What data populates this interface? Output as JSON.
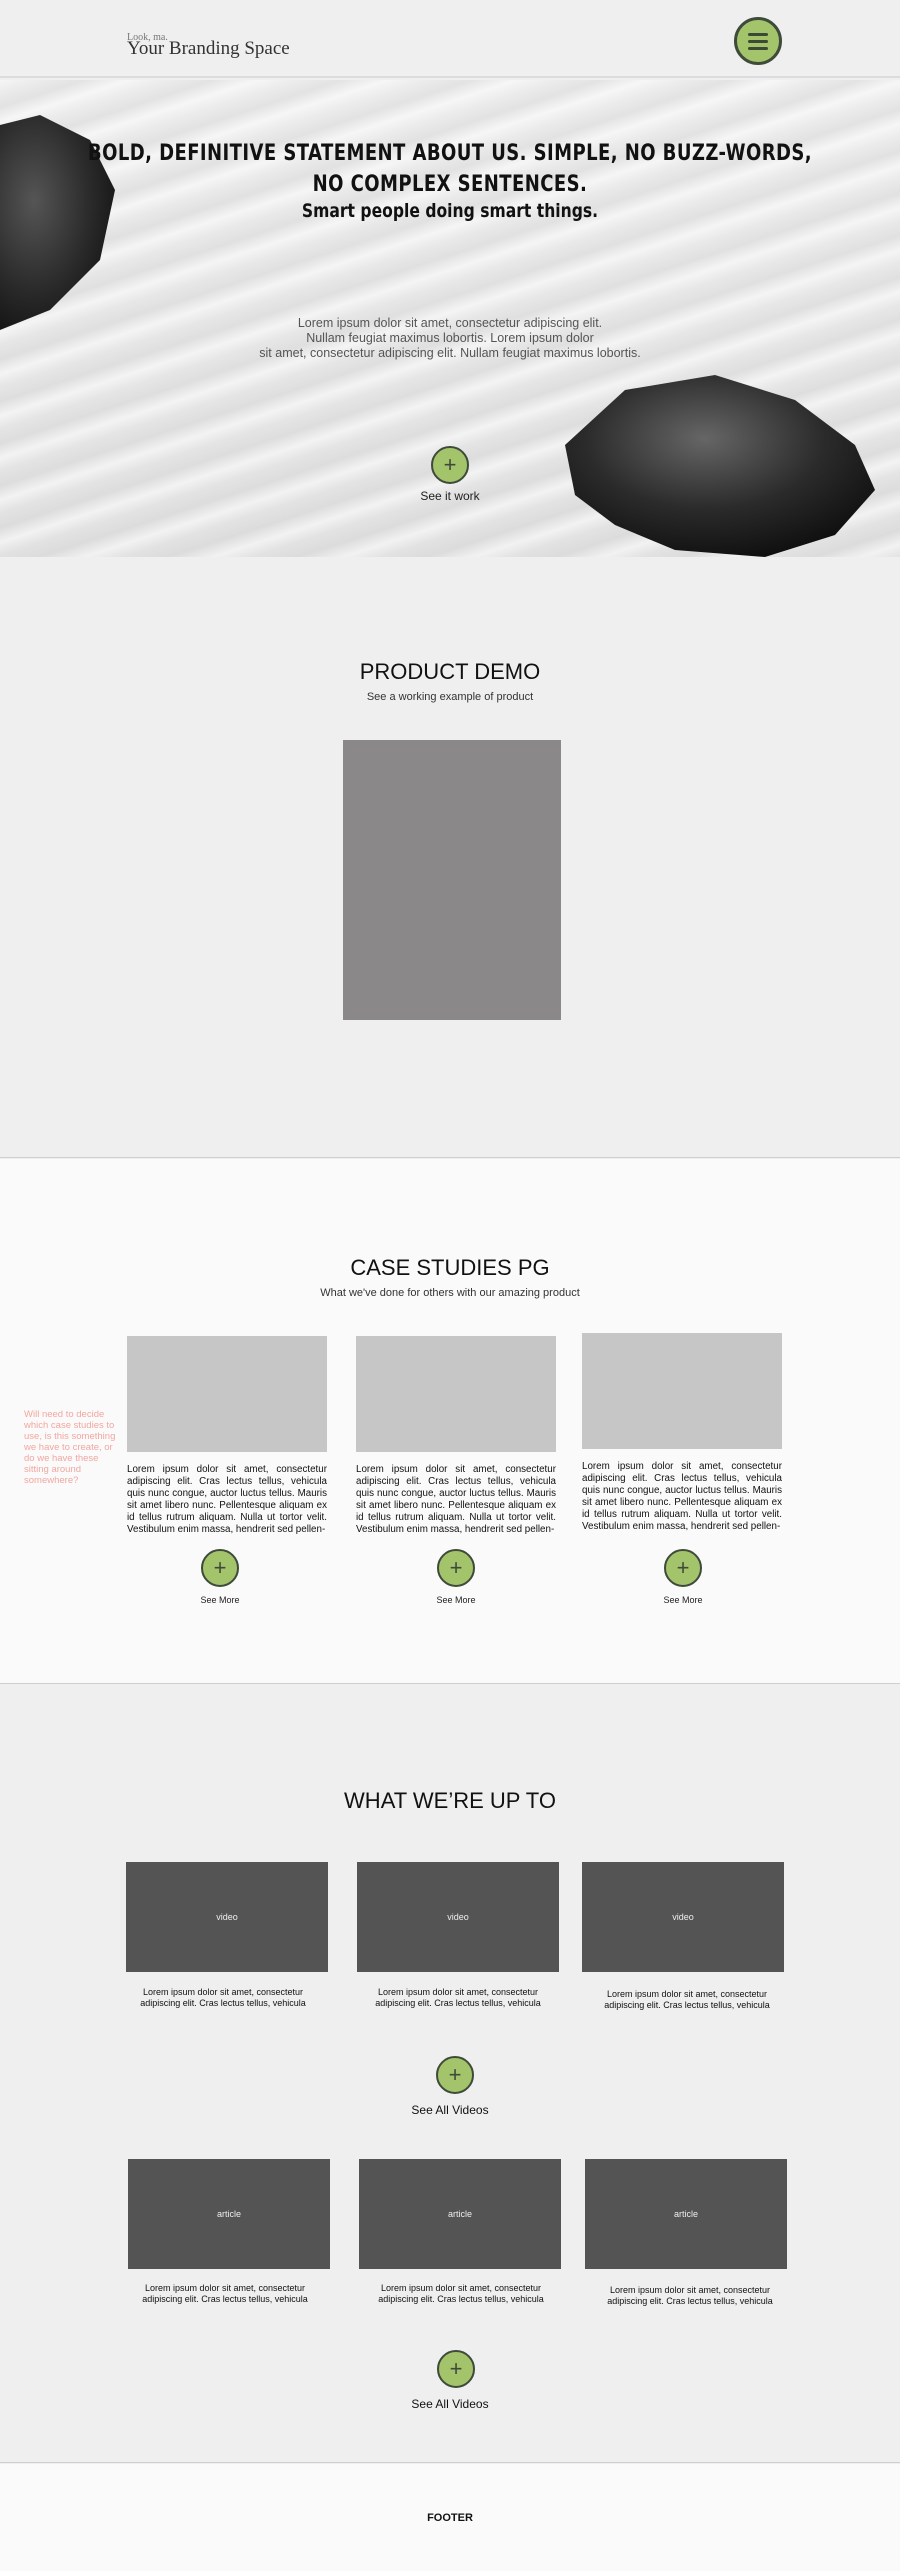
{
  "header": {
    "tagline_small": "Look, ma.",
    "brand": "Your Branding Space",
    "menu_icon": "hamburger-icon",
    "accent": "#a3c46a"
  },
  "hero": {
    "title_line1": "BOLD, DEFINITIVE STATEMENT ABOUT US. SIMPLE, NO BUZZ-WORDS,",
    "title_line2": "NO COMPLEX SENTENCES.",
    "subtitle": "Smart people doing smart things.",
    "lorem_line1": "Lorem ipsum dolor sit amet, consectetur adipiscing elit.",
    "lorem_line2": "Nullam feugiat maximus lobortis. Lorem ipsum dolor",
    "lorem_line3": "sit amet, consectetur adipiscing elit. Nullam feugiat maximus lobortis.",
    "cta_icon": "plus-icon",
    "cta_label": "See it work"
  },
  "demo": {
    "title": "PRODUCT DEMO",
    "subtitle": "See a working example of product"
  },
  "cases": {
    "title": "CASE STUDIES PG",
    "subtitle": "What we've done for others with our amazing product",
    "note": "Will need to decide which case studies to use, is this something we have to create, or do we have these sitting around somewhere?",
    "cards": [
      {
        "text": "Lorem ipsum dolor sit amet, consectetur adipiscing elit. Cras lectus tellus, vehicula quis nunc congue, auctor luctus tellus. Mauris sit amet libero nunc. Pellentesque aliquam ex id tellus rutrum aliquam. Nulla ut tortor velit. Vestibulum enim massa, hendrerit sed pellen-",
        "link": "See More"
      },
      {
        "text": "Lorem ipsum dolor sit amet, consectetur adipiscing elit. Cras lectus tellus, vehicula quis nunc congue, auctor luctus tellus. Mauris sit amet libero nunc. Pellentesque aliquam ex id tellus rutrum aliquam. Nulla ut tortor velit. Vestibulum enim massa, hendrerit sed pellen-",
        "link": "See More"
      },
      {
        "text": "Lorem ipsum dolor sit amet, consectetur adipiscing elit. Cras lectus tellus, vehicula quis nunc congue, auctor luctus tellus. Mauris sit amet libero nunc. Pellentesque aliquam ex id tellus rutrum aliquam. Nulla ut tortor velit. Vestibulum enim massa, hendrerit sed pellen-",
        "link": "See More"
      }
    ]
  },
  "upto": {
    "title": "WHAT WE’RE UP TO",
    "videos": [
      {
        "label": "video",
        "line1": "Lorem ipsum dolor sit amet, consectetur",
        "line2": "adipiscing elit. Cras lectus tellus, vehicula"
      },
      {
        "label": "video",
        "line1": "Lorem ipsum dolor sit amet, consectetur",
        "line2": "adipiscing elit. Cras lectus tellus, vehicula"
      },
      {
        "label": "video",
        "line1": "Lorem ipsum dolor sit amet, consectetur",
        "line2": "adipiscing elit. Cras lectus tellus, vehicula"
      }
    ],
    "videos_link": "See All Videos",
    "articles": [
      {
        "label": "article",
        "line1": "Lorem ipsum dolor sit amet, consectetur",
        "line2": "adipiscing elit. Cras lectus tellus, vehicula"
      },
      {
        "label": "article",
        "line1": "Lorem ipsum dolor sit amet, consectetur",
        "line2": "adipiscing elit. Cras lectus tellus, vehicula"
      },
      {
        "label": "article",
        "line1": "Lorem ipsum dolor sit amet, consectetur",
        "line2": "adipiscing elit. Cras lectus tellus, vehicula"
      }
    ],
    "articles_link": "See All Videos"
  },
  "footer": {
    "label": "FOOTER"
  }
}
